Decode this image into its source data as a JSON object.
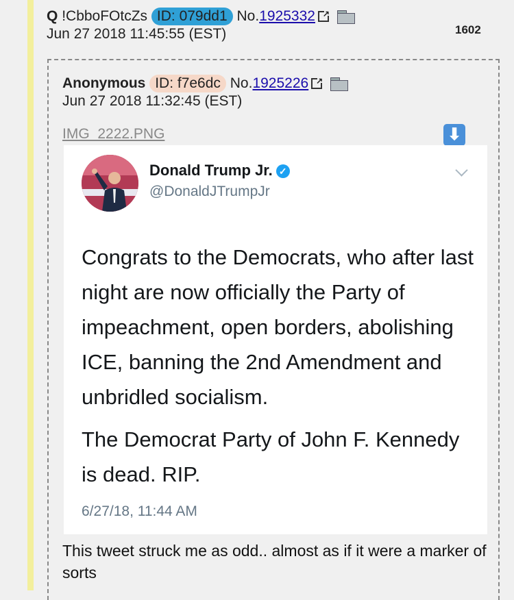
{
  "post": {
    "name": "Q",
    "tripcode": "!CbboFOtcZs",
    "id_label": "ID: 079dd1",
    "no_prefix": "No.",
    "number": "1925332",
    "date": "Jun 27 2018 11:45:55 (EST)",
    "count": "1602",
    "id_color": "#2fa0d6"
  },
  "reply": {
    "name": "Anonymous",
    "id_label": "ID: f7e6dc",
    "id_color": "#f6d8c8",
    "no_prefix": "No.",
    "number": "1925226",
    "date": "Jun 27 2018 11:32:45 (EST)",
    "file_name": "IMG_2222.PNG",
    "download_icon": "⬇",
    "comment": "This tweet struck me as odd.. almost as if it were a marker of sorts"
  },
  "tweet": {
    "display_name": "Donald Trump Jr.",
    "handle": "@DonaldJTrumpJr",
    "paragraphs": [
      "Congrats to the Democrats, who after last night are now officially the Party of impeachment, open borders, abolishing ICE, banning the 2nd Amendment and unbridled socialism.",
      "The Democrat Party of John F. Kennedy is dead. RIP."
    ],
    "timestamp": "6/27/18, 11:44 AM",
    "verified_mark": "✓"
  }
}
